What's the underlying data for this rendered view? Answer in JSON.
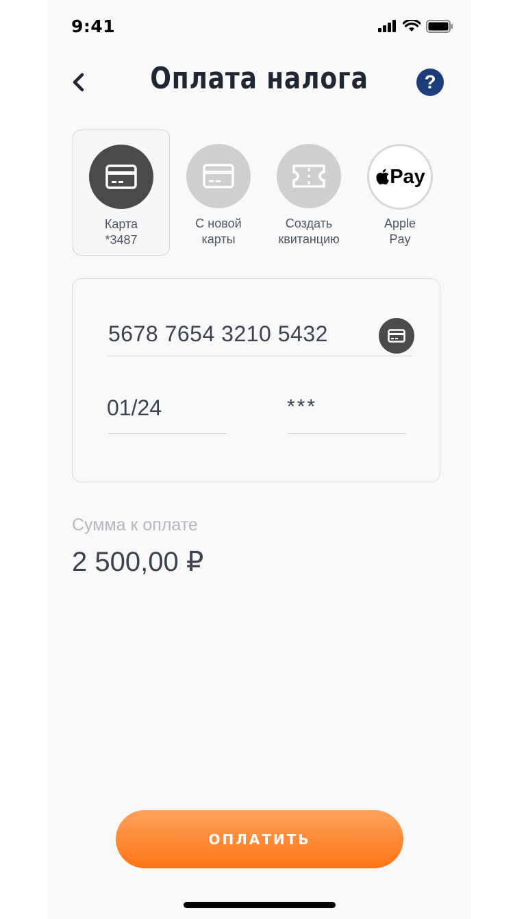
{
  "status_bar": {
    "time": "9:41"
  },
  "header": {
    "title": "Оплата налога",
    "help_label": "?"
  },
  "payment_methods": [
    {
      "line1": "Карта",
      "line2": "*3487",
      "icon": "credit-card-icon",
      "selected": true
    },
    {
      "line1": "С новой",
      "line2": "карты",
      "icon": "credit-card-icon",
      "selected": false
    },
    {
      "line1": "Создать",
      "line2": "квитанцию",
      "icon": "ticket-icon",
      "selected": false
    },
    {
      "line1": "Apple",
      "line2": "Pay",
      "icon": "apple-pay-icon",
      "selected": false
    }
  ],
  "apple_pay_badge": "Pay",
  "card_form": {
    "card_number": "5678 7654 3210 5432",
    "expiry": "01/24",
    "cvv": "***"
  },
  "amount": {
    "label": "Сумма к оплате",
    "value": "2 500,00 ₽"
  },
  "pay_button": {
    "label": "ОПЛАТИТЬ"
  },
  "colors": {
    "accent": "#ff7d22",
    "help": "#1d3d78",
    "selected_icon_bg": "#4a4a4a"
  }
}
